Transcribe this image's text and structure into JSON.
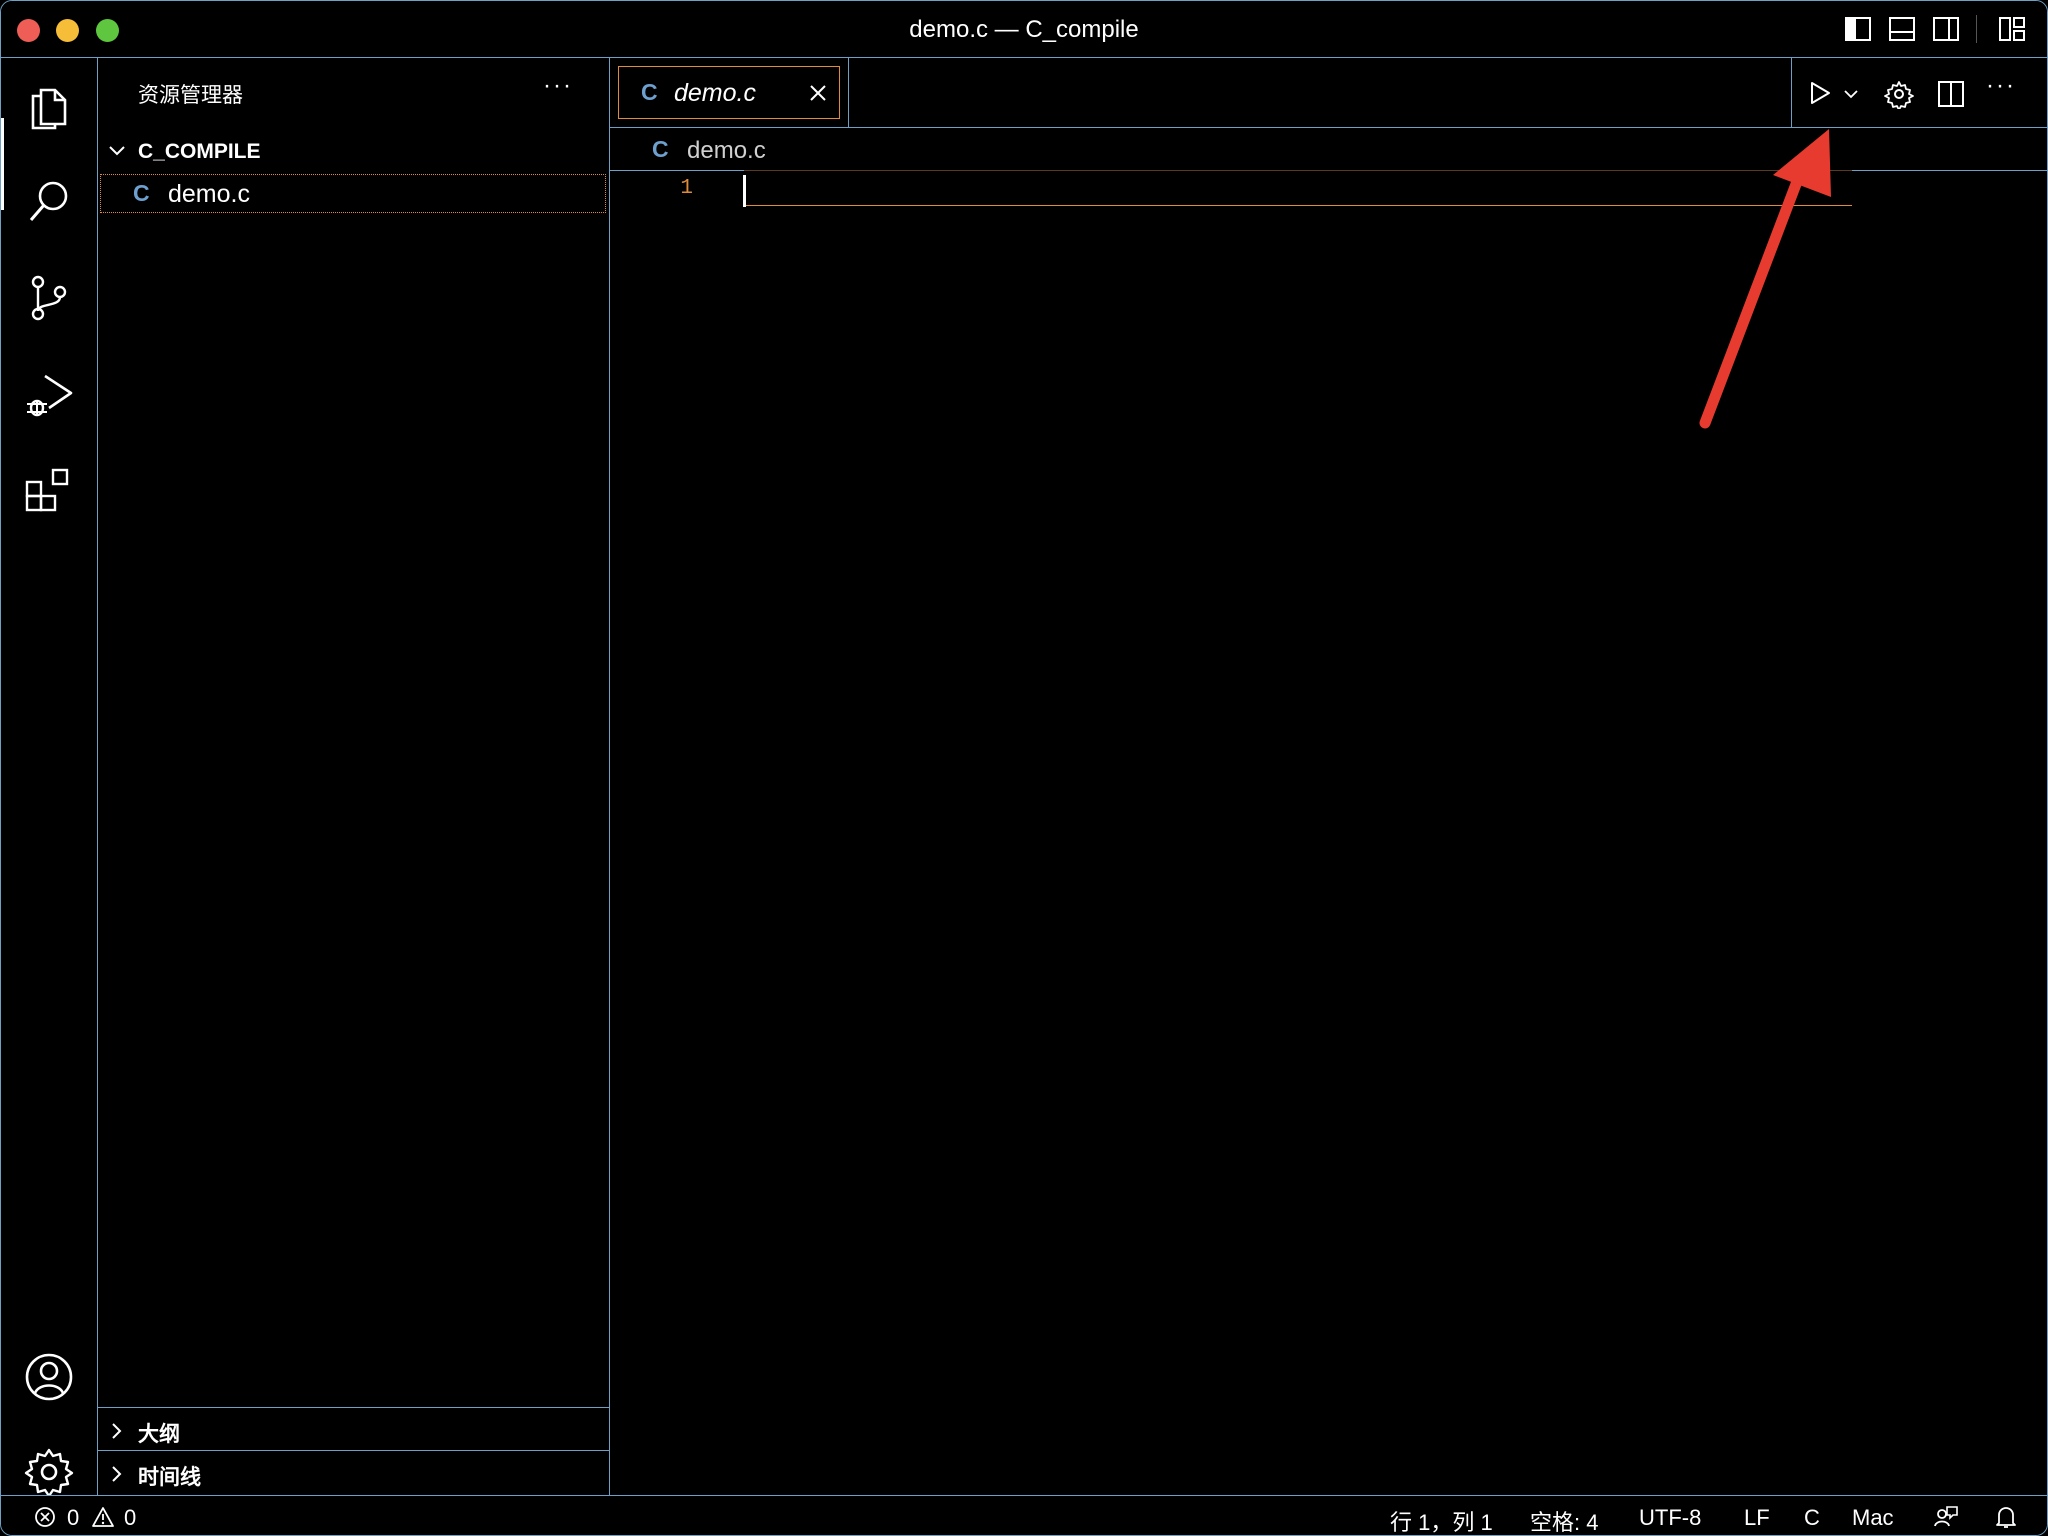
{
  "window": {
    "title": "demo.c — C_compile",
    "traffic_colors": [
      "#ee5e57",
      "#f6bd39",
      "#5fc73f"
    ]
  },
  "titlebar_icons": [
    "toggle-primary-sidebar-icon",
    "toggle-panel-icon",
    "toggle-secondary-sidebar-icon",
    "customize-layout-icon"
  ],
  "activity_bar": {
    "items": [
      "explorer-icon",
      "search-icon",
      "source-control-icon",
      "run-and-debug-icon",
      "extensions-icon"
    ],
    "bottom": [
      "accounts-icon",
      "manage-gear-icon"
    ]
  },
  "sidebar": {
    "title": "资源管理器",
    "more": "···",
    "folder": "C_COMPILE",
    "file_icon": "C",
    "file": "demo.c",
    "sections": [
      {
        "label": "大纲"
      },
      {
        "label": "时间线"
      }
    ]
  },
  "editor": {
    "tab": {
      "icon": "C",
      "label": "demo.c"
    },
    "breadcrumb": {
      "icon": "C",
      "label": "demo.c"
    },
    "line_number": "1",
    "actions": [
      "run-icon",
      "run-dropdown-icon",
      "settings-gear-icon",
      "split-editor-icon",
      "more-actions-icon"
    ]
  },
  "annotation": {
    "color": "#e63b2e"
  },
  "statusbar": {
    "errors": "0",
    "warnings": "0",
    "position": "行 1，列 1",
    "spaces": "空格: 4",
    "encoding": "UTF-8",
    "eol": "LF",
    "language": "C",
    "platform": "Mac"
  },
  "colors": {
    "border": "#6e9fc4",
    "focus": "#e08a3a",
    "c_icon": "#6d9fcf"
  }
}
